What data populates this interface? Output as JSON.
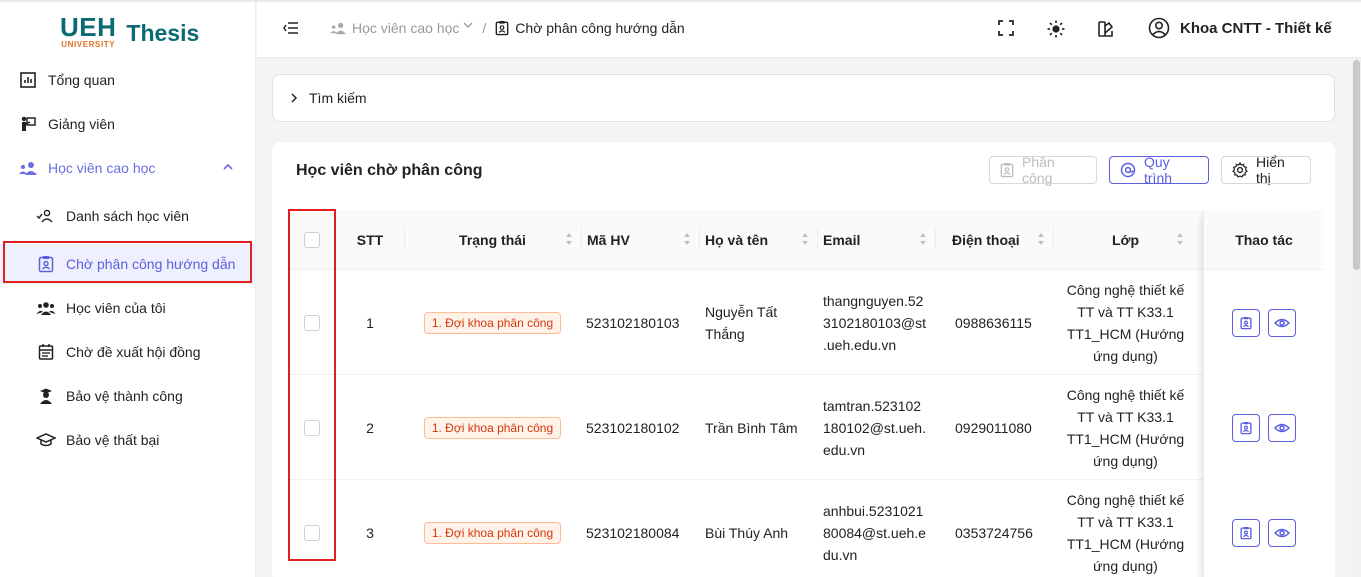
{
  "app": {
    "logo_main": "UEH",
    "logo_sub": "UNIVERSITY",
    "logo_product": "Thesis"
  },
  "sidebar": {
    "items": [
      {
        "label": "Tổng quan",
        "icon": "chart-icon"
      },
      {
        "label": "Giảng viên",
        "icon": "teacher-icon"
      },
      {
        "label": "Học viên cao học",
        "icon": "students-group-icon"
      },
      {
        "label": "Danh sách học viên",
        "icon": "user-list-icon"
      },
      {
        "label": "Chờ phân công hướng dẫn",
        "icon": "clipboard-user-icon"
      },
      {
        "label": "Học viên của tôi",
        "icon": "users-icon"
      },
      {
        "label": "Chờ đề xuất hội đồng",
        "icon": "calendar-icon"
      },
      {
        "label": "Bảo vệ thành công",
        "icon": "graduate-icon"
      },
      {
        "label": "Bảo vệ thất bại",
        "icon": "mortarboard-icon"
      }
    ]
  },
  "header": {
    "breadcrumb_parent": "Học viên cao học",
    "breadcrumb_current": "Chờ phân công hướng dẫn",
    "user_name": "Khoa CNTT - Thiết kế"
  },
  "search": {
    "label": "Tìm kiếm"
  },
  "card": {
    "title": "Học viên chờ phân công",
    "btn_assign": "Phân công",
    "btn_process": "Quy trình",
    "btn_display": "Hiển thị"
  },
  "table": {
    "columns": {
      "stt": "STT",
      "status": "Trạng thái",
      "code": "Mã HV",
      "name": "Họ và tên",
      "email": "Email",
      "phone": "Điện thoại",
      "class": "Lớp",
      "actions": "Thao tác"
    },
    "rows": [
      {
        "stt": "1",
        "status": "1. Đợi khoa phân công",
        "code": "523102180103",
        "name_1": "Nguyễn Tất",
        "name_2": "Thắng",
        "email_1": "thangnguyen.52",
        "email_2": "3102180103@st",
        "email_3": ".ueh.edu.vn",
        "phone": "0988636115",
        "class_1": "Công nghệ thiết kế",
        "class_2": "TT và TT K33.1",
        "class_3": "TT1_HCM (Hướng",
        "class_4": "ứng dụng)"
      },
      {
        "stt": "2",
        "status": "1. Đợi khoa phân công",
        "code": "523102180102",
        "name_1": "Trần Bình Tâm",
        "name_2": "",
        "email_1": "tamtran.523102",
        "email_2": "180102@st.ueh.",
        "email_3": "edu.vn",
        "phone": "0929011080",
        "class_1": "Công nghệ thiết kế",
        "class_2": "TT và TT K33.1",
        "class_3": "TT1_HCM (Hướng",
        "class_4": "ứng dụng)"
      },
      {
        "stt": "3",
        "status": "1. Đợi khoa phân công",
        "code": "523102180084",
        "name_1": "Bùi Thúy Anh",
        "name_2": "",
        "email_1": "anhbui.5231021",
        "email_2": "80084@st.ueh.e",
        "email_3": "du.vn",
        "phone": "0353724756",
        "class_1": "Công nghệ thiết kế",
        "class_2": "TT và TT K33.1",
        "class_3": "TT1_HCM (Hướng",
        "class_4": "ứng dụng)"
      }
    ]
  },
  "colors": {
    "brand": "#0b6b73",
    "accent": "#5b5fde",
    "highlight_box": "#e0201f",
    "status_badge": "#d4380d"
  }
}
